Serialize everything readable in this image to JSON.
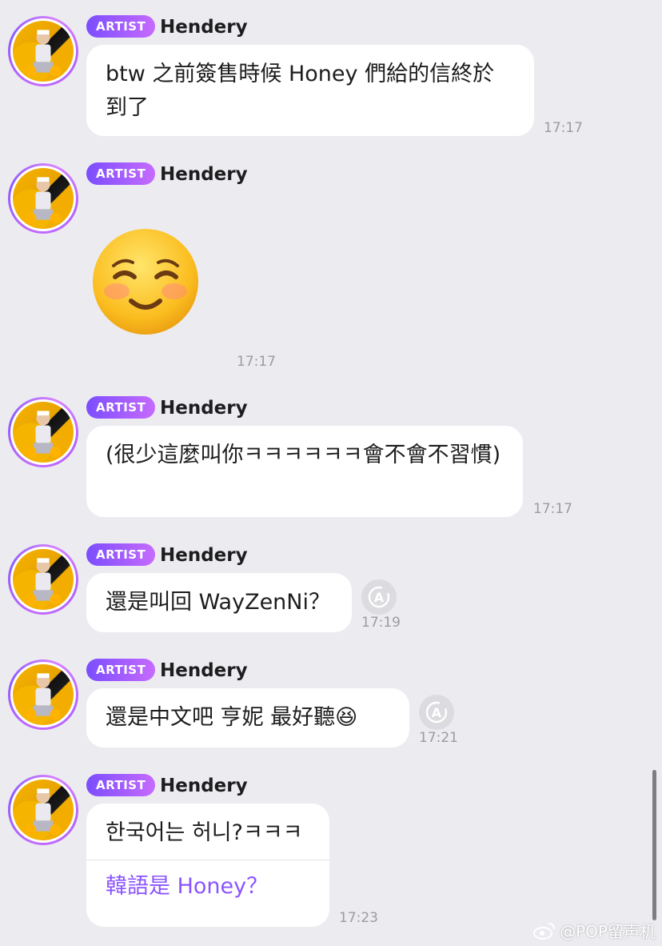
{
  "colors": {
    "background": "#ececf0",
    "badge_start": "#7b4dff",
    "badge_end": "#c66bff",
    "translated_text": "#8b54ff"
  },
  "messages": [
    {
      "badge": "ARTIST",
      "sender": "Hendery",
      "text": "btw 之前簽售時候 Honey 們給的信終於到了",
      "time": "17:17"
    },
    {
      "badge": "ARTIST",
      "sender": "Hendery",
      "emoji": "☺️",
      "time": "17:17"
    },
    {
      "badge": "ARTIST",
      "sender": "Hendery",
      "text": "(很少這麼叫你ㅋㅋㅋㅋㅋㅋ會不會不習慣)",
      "time": "17:17"
    },
    {
      "badge": "ARTIST",
      "sender": "Hendery",
      "text": "還是叫回 WayZenNi？",
      "time": "17:19",
      "icon": "translate-icon"
    },
    {
      "badge": "ARTIST",
      "sender": "Hendery",
      "text": "還是中文吧 亨妮 最好聽😆",
      "time": "17:21",
      "icon": "translate-icon"
    },
    {
      "badge": "ARTIST",
      "sender": "Hendery",
      "text": "한국어는 허니?ㅋㅋㅋ",
      "translation": "韓語是 Honey？",
      "time": "17:23"
    }
  ],
  "watermark": "@POP留声机"
}
